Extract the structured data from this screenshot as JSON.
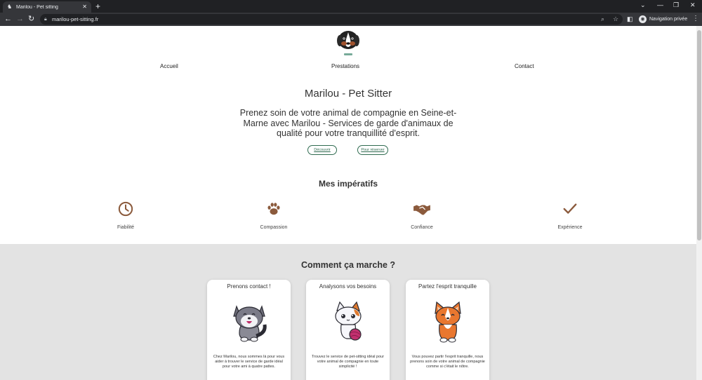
{
  "browser": {
    "tab_title": "Marilou - Pet sitting",
    "tab_close": "✕",
    "new_tab": "+",
    "url": "marilou-pet-sitting.fr",
    "private_label": "Navigation privée",
    "window_controls": {
      "list": "⌄",
      "minimize": "—",
      "restore": "❐",
      "close": "✕"
    }
  },
  "site": {
    "nav": {
      "home": "Accueil",
      "services": "Prestations",
      "contact": "Contact"
    },
    "hero": {
      "title": "Marilou - Pet Sitter",
      "subtitle": "Prenez soin de votre animal de compagnie en Seine-et-Marne avec Marilou - Services de garde d'animaux de qualité pour votre tranquillité d'esprit.",
      "discover_button": "Découvrir",
      "book_button": "Pour réserver"
    },
    "imperatives": {
      "title": "Mes impératifs",
      "items": [
        {
          "label": "Fiabilité",
          "icon": "clock-icon"
        },
        {
          "label": "Compassion",
          "icon": "paw-icon"
        },
        {
          "label": "Confiance",
          "icon": "handshake-icon"
        },
        {
          "label": "Expérience",
          "icon": "check-icon"
        }
      ]
    },
    "how_it_works": {
      "title": "Comment ça marche ?",
      "cards": [
        {
          "title": "Prenons contact !",
          "icon": "husky-icon",
          "text": "Chez Marilou, nous sommes là pour vous aider à trouver le service de garde idéal pour votre ami à quatre pattes."
        },
        {
          "title": "Analysons vos besoins",
          "icon": "cat-icon",
          "text": "Trouvez le service de pet-sitting idéal pour votre animal de compagnie en toute simplicité !"
        },
        {
          "title": "Partez l'esprit tranquille",
          "icon": "corgi-icon",
          "text": "Vous pouvez partir l'esprit tranquille, nous prenons soin de votre animal de compagnie comme si c'était le nôtre."
        }
      ]
    }
  },
  "colors": {
    "accent_brown": "#8b5a3c",
    "button_green": "#2f6b50",
    "section_gray": "#e3e3e3"
  }
}
